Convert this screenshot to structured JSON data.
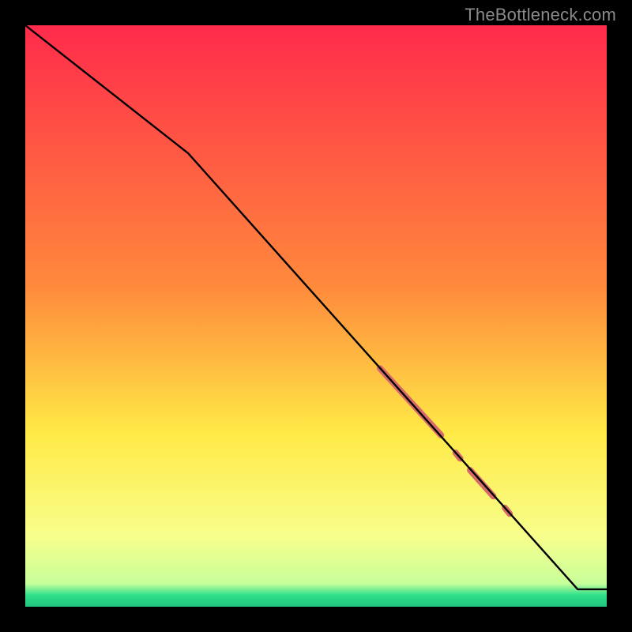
{
  "watermark": "TheBottleneck.com",
  "colors": {
    "gradient_top": "#ff2b4b",
    "gradient_mid1": "#ff8a3c",
    "gradient_mid2": "#ffe946",
    "gradient_low": "#f7ff8c",
    "gradient_green": "#2fe08b",
    "line": "#000000",
    "marker": "#d76a6a",
    "background": "#000000"
  },
  "chart_data": {
    "type": "line",
    "title": "",
    "xlabel": "",
    "ylabel": "",
    "xlim": [
      0,
      100
    ],
    "ylim": [
      0,
      100
    ],
    "axes_visible": false,
    "line": {
      "x": [
        0,
        28,
        95,
        100
      ],
      "y": [
        100,
        78,
        3,
        3
      ]
    },
    "highlight_segments": [
      {
        "x0": 61.0,
        "y0": 41.0,
        "x1": 71.5,
        "y1": 29.5,
        "width": 8
      },
      {
        "x0": 74.0,
        "y0": 26.5,
        "x1": 74.8,
        "y1": 25.5,
        "width": 8
      },
      {
        "x0": 76.5,
        "y0": 23.5,
        "x1": 80.5,
        "y1": 19.0,
        "width": 8
      },
      {
        "x0": 82.5,
        "y0": 17.0,
        "x1": 83.3,
        "y1": 16.0,
        "width": 8
      }
    ],
    "gradient_stops": [
      {
        "pct": 0,
        "color": "#ff2b4b"
      },
      {
        "pct": 45,
        "color": "#ff8a3c"
      },
      {
        "pct": 70,
        "color": "#ffe946"
      },
      {
        "pct": 88,
        "color": "#f7ff8c"
      },
      {
        "pct": 96,
        "color": "#c8ff9a"
      },
      {
        "pct": 98,
        "color": "#2fe08b"
      },
      {
        "pct": 100,
        "color": "#22c37e"
      }
    ]
  }
}
